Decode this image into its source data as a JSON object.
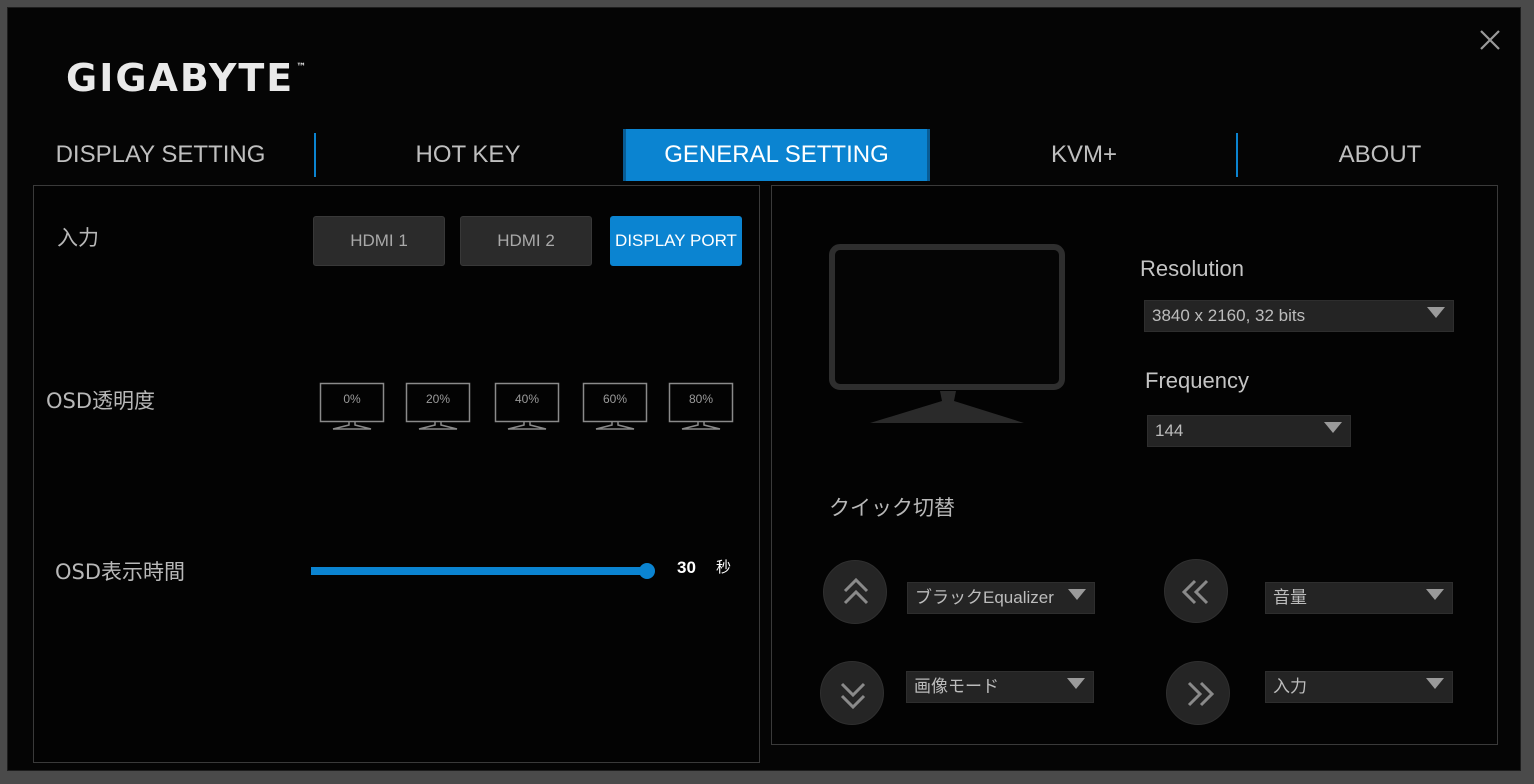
{
  "app": {
    "logo_text": "GIGABYTE",
    "logo_tm": "™",
    "accent_color": "#0b84d1",
    "close_icon": "close-icon"
  },
  "tabs": [
    {
      "label": "DISPLAY SETTING",
      "active": false
    },
    {
      "label": "HOT KEY",
      "active": false
    },
    {
      "label": "GENERAL SETTING",
      "active": true
    },
    {
      "label": "KVM+",
      "active": false
    },
    {
      "label": "ABOUT",
      "active": false
    }
  ],
  "input": {
    "label": "入力",
    "options": [
      "HDMI 1",
      "HDMI 2",
      "DISPLAY PORT"
    ],
    "selected": "DISPLAY PORT"
  },
  "osd_transparency": {
    "label": "OSD透明度",
    "options": [
      "0%",
      "20%",
      "40%",
      "60%",
      "80%"
    ]
  },
  "osd_time": {
    "label": "OSD表示時間",
    "value": "30",
    "unit": "秒",
    "fraction": 1.0
  },
  "resolution": {
    "label": "Resolution",
    "value": "3840 x 2160, 32 bits"
  },
  "frequency": {
    "label": "Frequency",
    "value": "144"
  },
  "quick_switch": {
    "label": "クイック切替",
    "up": {
      "icon": "double-chevron-up-icon",
      "value": "ブラックEqualizer"
    },
    "down": {
      "icon": "double-chevron-down-icon",
      "value": "画像モード"
    },
    "left": {
      "icon": "double-chevron-left-icon",
      "value": "音量"
    },
    "right": {
      "icon": "double-chevron-right-icon",
      "value": "入力"
    }
  }
}
